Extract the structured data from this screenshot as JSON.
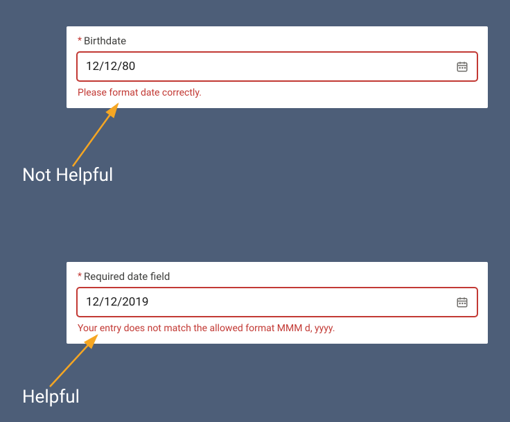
{
  "example1": {
    "label": "Birthdate",
    "required": "*",
    "value": "12/12/80",
    "error": "Please format date correctly.",
    "caption": "Not Helpful"
  },
  "example2": {
    "label": "Required date field",
    "required": "*",
    "value": "12/12/2019",
    "error": "Your entry does not match the allowed format MMM d, yyyy.",
    "caption": "Helpful"
  }
}
